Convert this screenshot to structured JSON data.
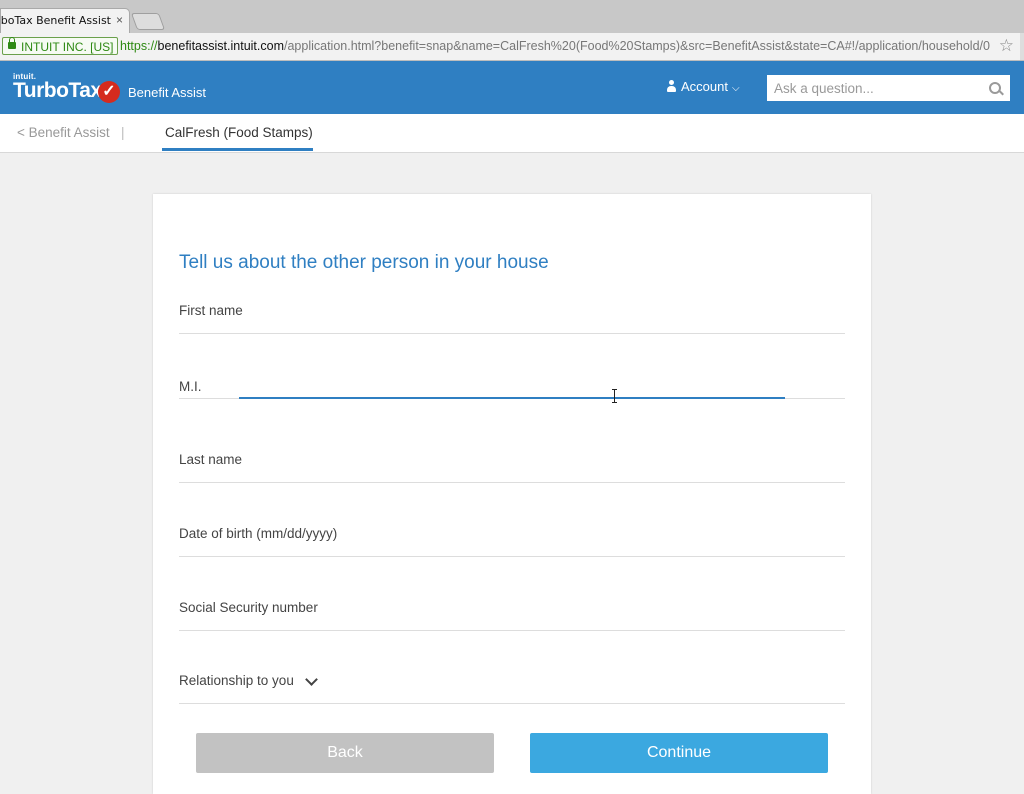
{
  "browser": {
    "tab_title": "rboTax Benefit Assist",
    "tab_close": "×",
    "secure_label": "INTUIT INC. [US]",
    "url_scheme": "https://",
    "url_host": "benefitassist.intuit.com",
    "url_path": "/application.html?benefit=snap&name=CalFresh%20(Food%20Stamps)&src=BenefitAssist&state=CA#!/application/household/0",
    "star_glyph": "☆"
  },
  "header": {
    "brand_parent": "intuit.",
    "brand_name": "TurboTax",
    "brand_check": "✓",
    "product_name": "Benefit Assist",
    "account_label": "Account",
    "account_chevron": "⌵",
    "search_placeholder": "Ask a question..."
  },
  "subnav": {
    "back_label": "< Benefit Assist",
    "separator": "|",
    "active_tab": "CalFresh (Food Stamps)"
  },
  "form": {
    "title": "Tell us about the other person in your house",
    "fields": [
      {
        "label": "First name",
        "value": ""
      },
      {
        "label": "M.I.",
        "value": ""
      },
      {
        "label": "Last name",
        "value": ""
      },
      {
        "label": "Date of birth (mm/dd/yyyy)",
        "value": ""
      },
      {
        "label": "Social Security number",
        "value": ""
      },
      {
        "label": "Relationship to you",
        "value": ""
      }
    ],
    "back_button": "Back",
    "continue_button": "Continue"
  },
  "colors": {
    "brand_blue": "#2f7fc2",
    "continue_blue": "#3ba8e0",
    "back_gray": "#c2c2c2",
    "turbotax_red": "#d52b1e"
  }
}
